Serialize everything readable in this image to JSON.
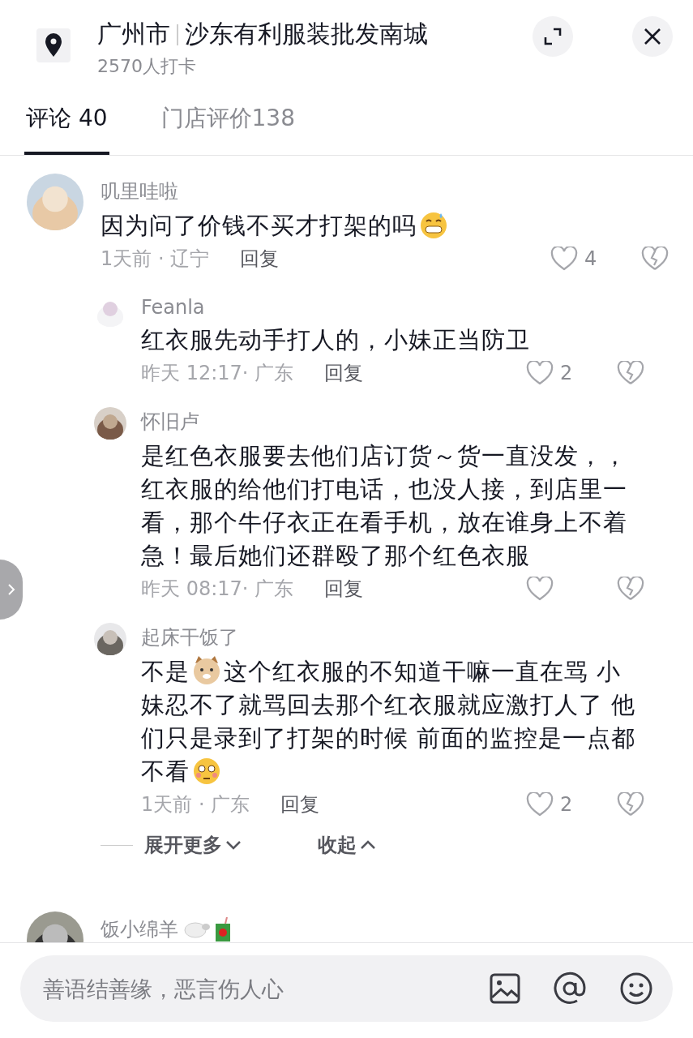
{
  "header": {
    "city": "广州市",
    "place": "沙东有利服装批发南城",
    "checkins": "2570人打卡"
  },
  "tabs": [
    {
      "label": "评论 40",
      "selected": true
    },
    {
      "label": "门店评价138",
      "selected": false
    }
  ],
  "comments": [
    {
      "name": "叽里哇啦",
      "segments": [
        {
          "kind": "text",
          "text": "因为问了价钱不买才打架的吗"
        },
        {
          "kind": "emoji-grin-sweat"
        }
      ],
      "meta": "1天前 · 辽宁",
      "reply_label": "回复",
      "likes": "4",
      "replies": [
        {
          "name": "Feanla",
          "segments": [
            {
              "kind": "text",
              "text": "红衣服先动手打人的，小妹正当防卫"
            }
          ],
          "meta": "昨天 12:17· 广东",
          "reply_label": "回复",
          "likes": "2"
        },
        {
          "name": "怀旧卢",
          "segments": [
            {
              "kind": "text",
              "text": "是红色衣服要去他们店订货～货一直没发，，红衣服的给他们打电话，也没人接，到店里一看，那个牛仔衣正在看手机，放在谁身上不着急！最后她们还群殴了那个红色衣服"
            }
          ],
          "meta": "昨天 08:17· 广东",
          "reply_label": "回复"
        },
        {
          "name": "起床干饭了",
          "segments": [
            {
              "kind": "text",
              "text": "不是"
            },
            {
              "kind": "emoji-cat"
            },
            {
              "kind": "text",
              "text": "这个红衣服的不知道干嘛一直在骂 小妹忍不了就骂回去那个红衣服就应激打人了 他们只是录到了打架的时候 前面的监控是一点都不看"
            },
            {
              "kind": "emoji-flushed"
            }
          ],
          "meta": "1天前 · 广东",
          "reply_label": "回复",
          "likes": "2"
        }
      ],
      "expand": "展开更多",
      "collapse": "收起"
    },
    {
      "name": "饭小绵羊",
      "name_icons": [
        {
          "kind": "sheep"
        },
        {
          "kind": "juice"
        }
      ]
    }
  ],
  "composer": {
    "placeholder": "善语结善缘，恶言伤人心"
  }
}
